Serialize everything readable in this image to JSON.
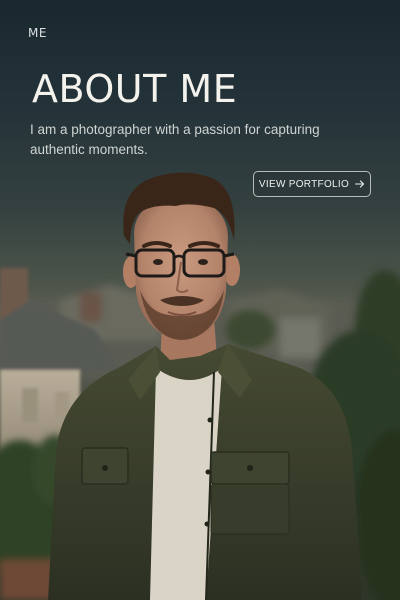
{
  "nav": {
    "logo": "ME"
  },
  "hero": {
    "title": "ABOUT ME",
    "intro": "I am a photographer with a passion for capturing authentic moments.",
    "cta_label": "VIEW PORTFOLIO",
    "cta_icon": "arrow-right-icon"
  },
  "colors": {
    "sky_top": "#1a2730",
    "jacket": "#3b3f2c",
    "text_primary": "#f4f2ec"
  }
}
